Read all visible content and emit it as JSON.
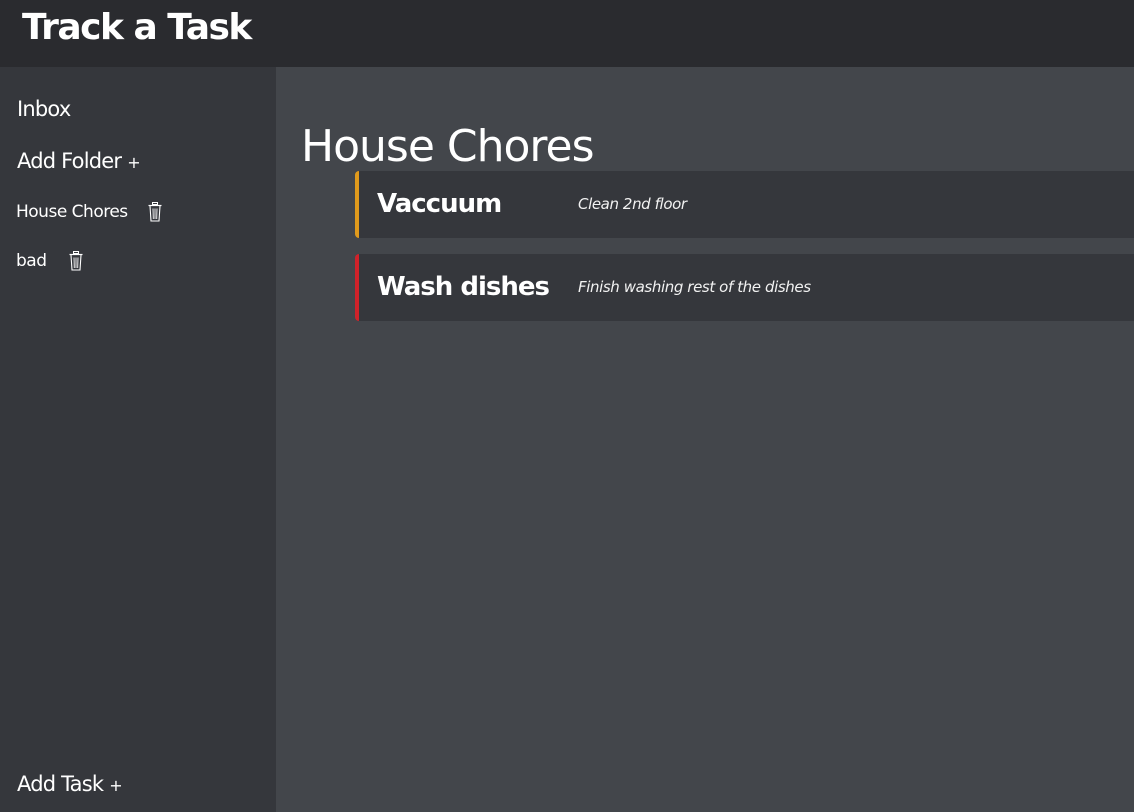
{
  "app": {
    "title": "Track a Task"
  },
  "sidebar": {
    "inbox_label": "Inbox",
    "add_folder_label": "Add Folder",
    "add_folder_plus": "+",
    "folders": [
      {
        "name": "House Chores",
        "icon": "trash-icon"
      },
      {
        "name": "bad",
        "icon": "trash-icon"
      }
    ],
    "add_task_label": "Add Task",
    "add_task_plus": "+"
  },
  "main": {
    "folder_title": "House Chores",
    "tasks": [
      {
        "name": "Vaccuum",
        "description": "Clean 2nd floor",
        "priority_color": "#e09a1c"
      },
      {
        "name": "Wash dishes",
        "description": "Finish washing rest of the dishes",
        "priority_color": "#d0222a"
      }
    ]
  },
  "colors": {
    "topbar": "#2a2b2f",
    "sidebar": "#35373c",
    "main": "#43464b",
    "card": "#35373c",
    "text": "#ffffff"
  }
}
